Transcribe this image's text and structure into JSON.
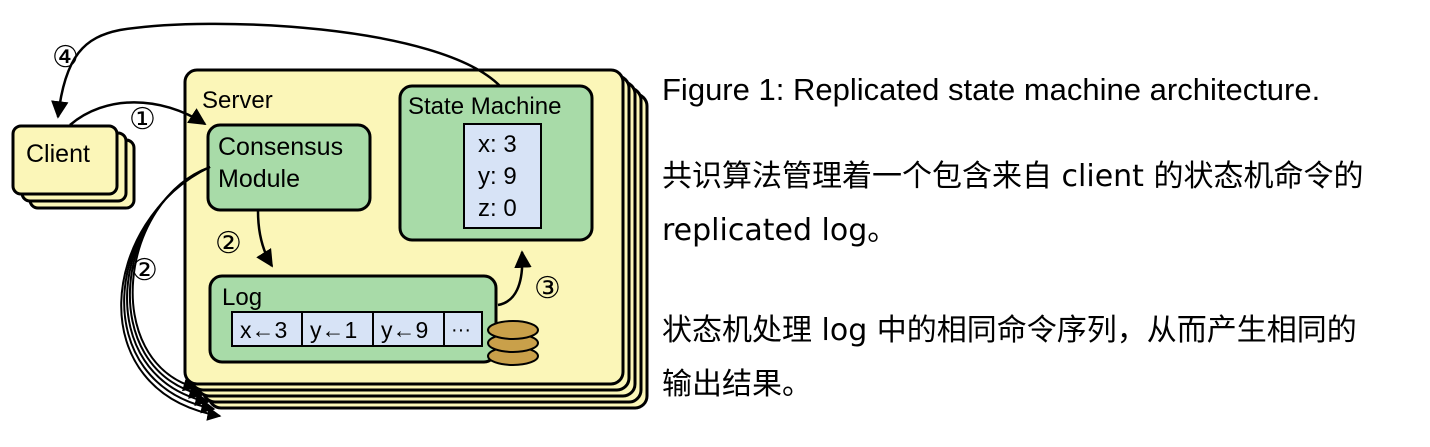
{
  "diagram": {
    "client_label": "Client",
    "server_label": "Server",
    "consensus_line1": "Consensus",
    "consensus_line2": "Module",
    "state_machine_label": "State Machine",
    "state_values": [
      "x: 3",
      "y: 9",
      "z: 0"
    ],
    "log_label": "Log",
    "log_entries": [
      "x←3",
      "y←1",
      "y←9",
      "···"
    ],
    "step_1": "①",
    "step_2": "②",
    "step_3": "③",
    "step_4": "④",
    "colors": {
      "server_fill": "#fbf6b8",
      "module_fill": "#a8dba8",
      "value_fill": "#d7e3f6",
      "disk_fill": "#c9a04a"
    }
  },
  "caption": {
    "figure_title": "Figure 1: Replicated state machine architecture.",
    "description_1_line1": "共识算法管理着一个包含来自 client 的状态机命令的",
    "description_1_line2": "replicated log。",
    "description_2_line1": "状态机处理 log 中的相同命令序列，从而产生相同的",
    "description_2_line2": "输出结果。"
  }
}
